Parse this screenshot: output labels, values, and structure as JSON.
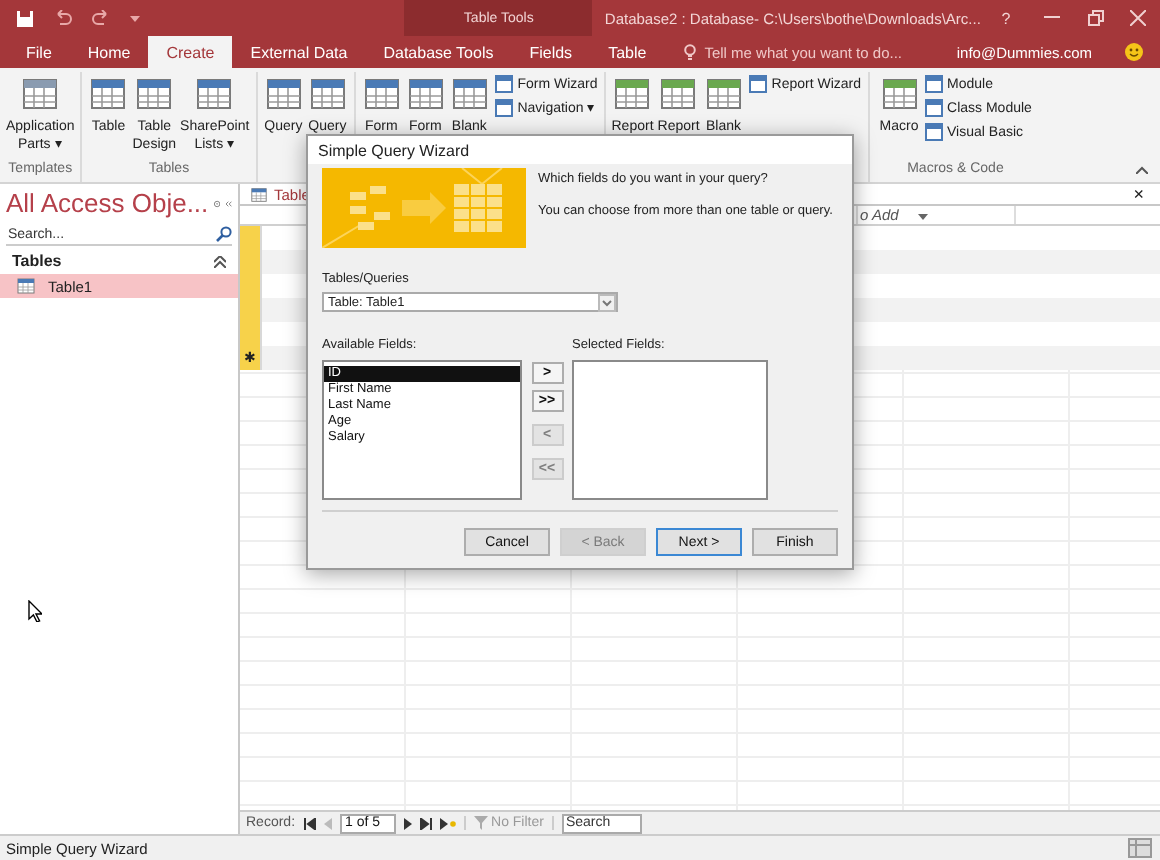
{
  "title_bar": {
    "context_label": "Table Tools",
    "title": "Database2 : Database- C:\\Users\\bothe\\Downloads\\Arc...",
    "help": "?"
  },
  "ribbon_tabs": [
    {
      "label": "File",
      "selected": false
    },
    {
      "label": "Home",
      "selected": false
    },
    {
      "label": "Create",
      "selected": true
    },
    {
      "label": "External Data",
      "selected": false
    },
    {
      "label": "Database Tools",
      "selected": false
    },
    {
      "label": "Fields",
      "selected": false
    },
    {
      "label": "Table",
      "selected": false
    }
  ],
  "tell_me": {
    "placeholder": "Tell me what you want to do..."
  },
  "account": "info@Dummies.com",
  "ribbon_groups": [
    {
      "label": "Templates",
      "buttons": [
        {
          "kind": "large",
          "label": "Application\nParts ▾"
        }
      ]
    },
    {
      "label": "Tables",
      "buttons": [
        {
          "kind": "large",
          "label": "Table"
        },
        {
          "kind": "large",
          "label": "Table\nDesign"
        },
        {
          "kind": "large",
          "label": "SharePoint\nLists ▾"
        }
      ]
    },
    {
      "buttons": [
        {
          "kind": "large",
          "label": "Query"
        },
        {
          "kind": "large",
          "label": "Query"
        }
      ]
    },
    {
      "buttons": [
        {
          "kind": "large",
          "label": "Form"
        },
        {
          "kind": "large",
          "label": "Form"
        },
        {
          "kind": "large",
          "label": "Blank"
        },
        {
          "kind": "small",
          "label": "Form Wizard"
        },
        {
          "kind": "small",
          "label": "Navigation ▾"
        }
      ]
    },
    {
      "buttons": [
        {
          "kind": "large",
          "label": "Report"
        },
        {
          "kind": "large",
          "label": "Report"
        },
        {
          "kind": "large",
          "label": "Blank"
        },
        {
          "kind": "small",
          "label": "Report Wizard"
        }
      ]
    },
    {
      "label": "Macros & Code",
      "buttons": [
        {
          "kind": "large",
          "label": "Macro"
        },
        {
          "kind": "small",
          "label": "Module"
        },
        {
          "kind": "small",
          "label": "Class Module"
        },
        {
          "kind": "small",
          "label": "Visual Basic"
        }
      ]
    }
  ],
  "nav_pane": {
    "title": "All Access Obje...",
    "search": {
      "placeholder": "Search..."
    },
    "sections": [
      {
        "label": "Tables",
        "items": [
          {
            "label": "Table1",
            "selected": true
          }
        ]
      }
    ]
  },
  "document": {
    "tab": "Table",
    "close": "×",
    "column_header": "o Add",
    "rows": [
      {
        "kind": "record",
        "selected": true
      },
      {
        "kind": "record",
        "selected": true
      },
      {
        "kind": "record",
        "selected": true
      },
      {
        "kind": "record",
        "selected": true
      },
      {
        "kind": "record",
        "selected": true
      },
      {
        "kind": "new",
        "selected": true,
        "marker": "✱"
      }
    ]
  },
  "dialog": {
    "title": "Simple Query Wizard",
    "question": "Which fields do you want in your query?",
    "hint": "You can choose from more than one table or query.",
    "source_label": "Tables/Queries",
    "source_value": "Table: Table1",
    "available_label": "Available Fields:",
    "available": [
      {
        "label": "ID",
        "selected": true
      },
      {
        "label": "First Name",
        "selected": false
      },
      {
        "label": "Last Name",
        "selected": false
      },
      {
        "label": "Age",
        "selected": false
      },
      {
        "label": "Salary",
        "selected": false
      }
    ],
    "selected_label": "Selected Fields:",
    "move_buttons": [
      {
        "label": ">",
        "disabled": false
      },
      {
        "label": ">>",
        "disabled": false
      },
      {
        "label": "<",
        "disabled": true
      },
      {
        "label": "<<",
        "disabled": true
      }
    ],
    "footer_buttons": [
      {
        "label": "Cancel",
        "disabled": false,
        "default": false
      },
      {
        "label": "< Back",
        "disabled": true,
        "default": false
      },
      {
        "label": "Next >",
        "disabled": false,
        "default": true
      },
      {
        "label": "Finish",
        "disabled": false,
        "default": false
      }
    ]
  },
  "record_bar": {
    "label": "Record:",
    "position": "1 of 5",
    "filter": "No Filter",
    "search": {
      "placeholder": "Search"
    }
  },
  "status_bar": {
    "text": "Simple Query Wizard"
  }
}
